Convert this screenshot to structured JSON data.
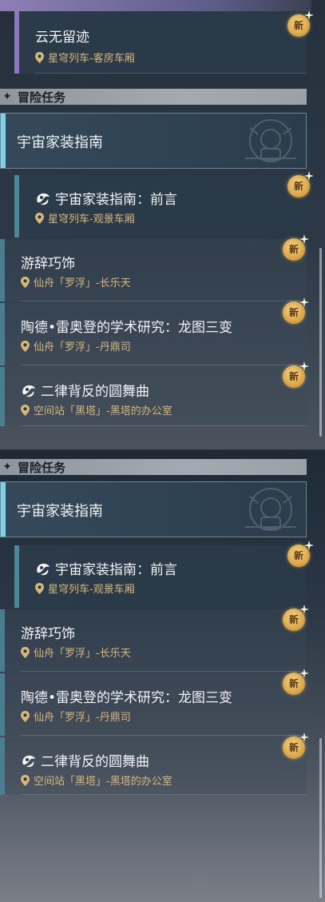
{
  "badge_label": "新",
  "panel1": {
    "top_item": {
      "name": "云无留迹",
      "location": "星穹列车-客房车厢"
    },
    "section_title": "冒险任务",
    "category_title": "宇宙家装指南",
    "sub_quest": {
      "name": "宇宙家装指南：前言",
      "location": "星穹列车-观景车厢"
    },
    "quests": [
      {
        "name": "游辞巧饰",
        "location": "仙舟「罗浮」-长乐天"
      },
      {
        "name": "陶德•雷奥登的学术研究：龙图三变",
        "location": "仙舟「罗浮」-丹鼎司"
      },
      {
        "name": "二律背反的圆舞曲",
        "location": "空间站「黑塔」-黑塔的办公室"
      }
    ]
  },
  "panel2": {
    "section_title": "冒险任务",
    "category_title": "宇宙家装指南",
    "sub_quest": {
      "name": "宇宙家装指南：前言",
      "location": "星穹列车-观景车厢"
    },
    "quests": [
      {
        "name": "游辞巧饰",
        "location": "仙舟「罗浮」-长乐天"
      },
      {
        "name": "陶德•雷奥登的学术研究：龙图三变",
        "location": "仙舟「罗浮」-丹鼎司"
      },
      {
        "name": "二律背反的圆舞曲",
        "location": "空间站「黑塔」-黑塔的办公室"
      }
    ]
  },
  "colors": {
    "accent_cyan": "#7fd1e6",
    "location_gold": "#d8b879",
    "badge_gold": "#dba646"
  }
}
